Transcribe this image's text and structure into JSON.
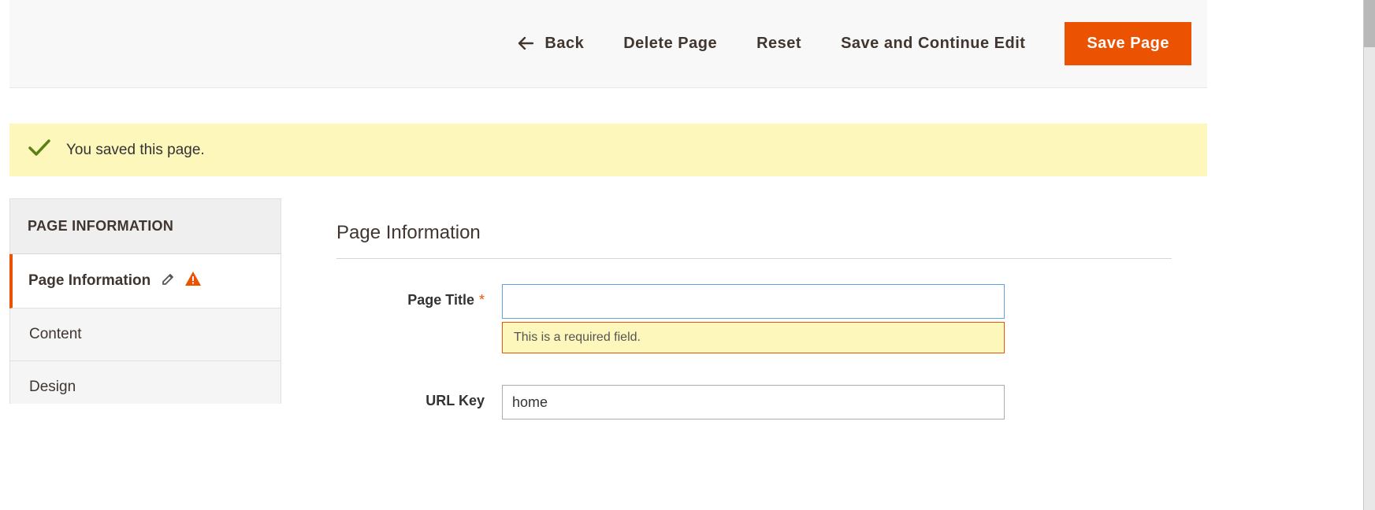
{
  "toolbar": {
    "back_label": "Back",
    "delete_label": "Delete Page",
    "reset_label": "Reset",
    "save_continue_label": "Save and Continue Edit",
    "save_label": "Save Page"
  },
  "message": {
    "text": "You saved this page."
  },
  "sidebar": {
    "header": "PAGE INFORMATION",
    "items": [
      {
        "label": "Page Information"
      },
      {
        "label": "Content"
      },
      {
        "label": "Design"
      }
    ]
  },
  "section": {
    "title": "Page Information"
  },
  "form": {
    "page_title": {
      "label": "Page Title",
      "value": "",
      "error": "This is a required field."
    },
    "url_key": {
      "label": "URL Key",
      "value": "home"
    }
  }
}
